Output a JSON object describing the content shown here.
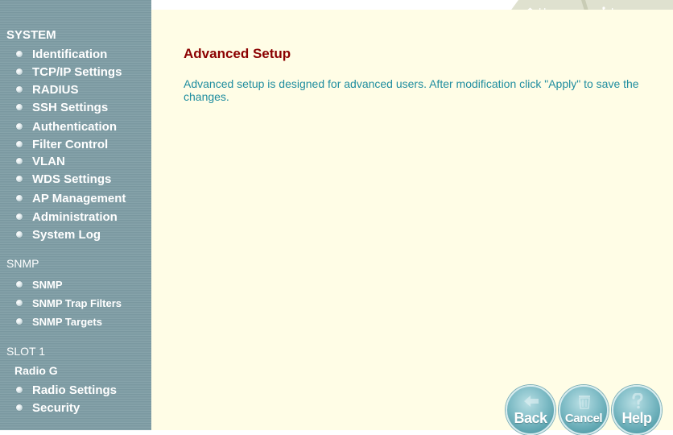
{
  "sidebar": {
    "system": {
      "header": "SYSTEM",
      "items": [
        {
          "label": "Identification"
        },
        {
          "label": "TCP/IP Settings"
        },
        {
          "label": "RADIUS"
        },
        {
          "label": "SSH Settings"
        },
        {
          "label": "Authentication"
        },
        {
          "label": "Filter Control"
        },
        {
          "label": "VLAN"
        },
        {
          "label": "WDS Settings"
        },
        {
          "label": "AP Management"
        },
        {
          "label": "Administration"
        },
        {
          "label": "System Log"
        }
      ]
    },
    "snmp": {
      "header": "SNMP",
      "items": [
        {
          "label": "SNMP"
        },
        {
          "label": "SNMP Trap Filters"
        },
        {
          "label": "SNMP Targets"
        }
      ]
    },
    "slot": {
      "header": "SLOT 1",
      "subheader": "Radio G",
      "items": [
        {
          "label": "Radio Settings"
        },
        {
          "label": "Security"
        }
      ]
    }
  },
  "topnav": {
    "home_label": "Home",
    "home_icon": "home-icon",
    "logout_label": "Logou",
    "logout_icon": "running-man-icon"
  },
  "main": {
    "title": "Advanced Setup",
    "description": "Advanced setup is designed for advanced users. After modification click \"Apply\" to save the changes."
  },
  "buttons": {
    "back": "Back",
    "cancel": "Cancel",
    "help": "Help"
  },
  "colors": {
    "sidebar_bg": "#7f9ea6",
    "content_bg": "#fffde6",
    "title": "#8b0000",
    "description": "#1f8d9f",
    "button": "#5fa7b2"
  }
}
